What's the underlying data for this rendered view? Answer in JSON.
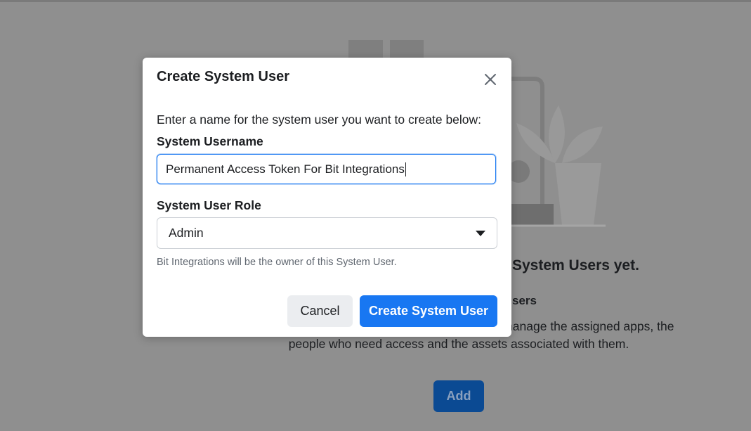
{
  "background": {
    "heading": "System Users yet.",
    "subheading": "sers",
    "body": "sted here. Click on any system user to see and manage the assigned apps, the people who need access and the assets associated with them.",
    "add_label": "Add"
  },
  "dialog": {
    "title": "Create System User",
    "close_icon": "close-icon",
    "intro": "Enter a name for the system user you want to create below:",
    "username_label": "System Username",
    "username_value": "Permanent Access Token For Bit Integrations",
    "role_label": "System User Role",
    "role_value": "Admin",
    "role_icon": "caret-down-icon",
    "helper": "Bit Integrations will be the owner of this System User.",
    "cancel_label": "Cancel",
    "create_label": "Create System User"
  },
  "colors": {
    "primary": "#1877f2",
    "overlay": "#8f8f8f",
    "text": "#1c1e21",
    "muted": "#606770"
  }
}
